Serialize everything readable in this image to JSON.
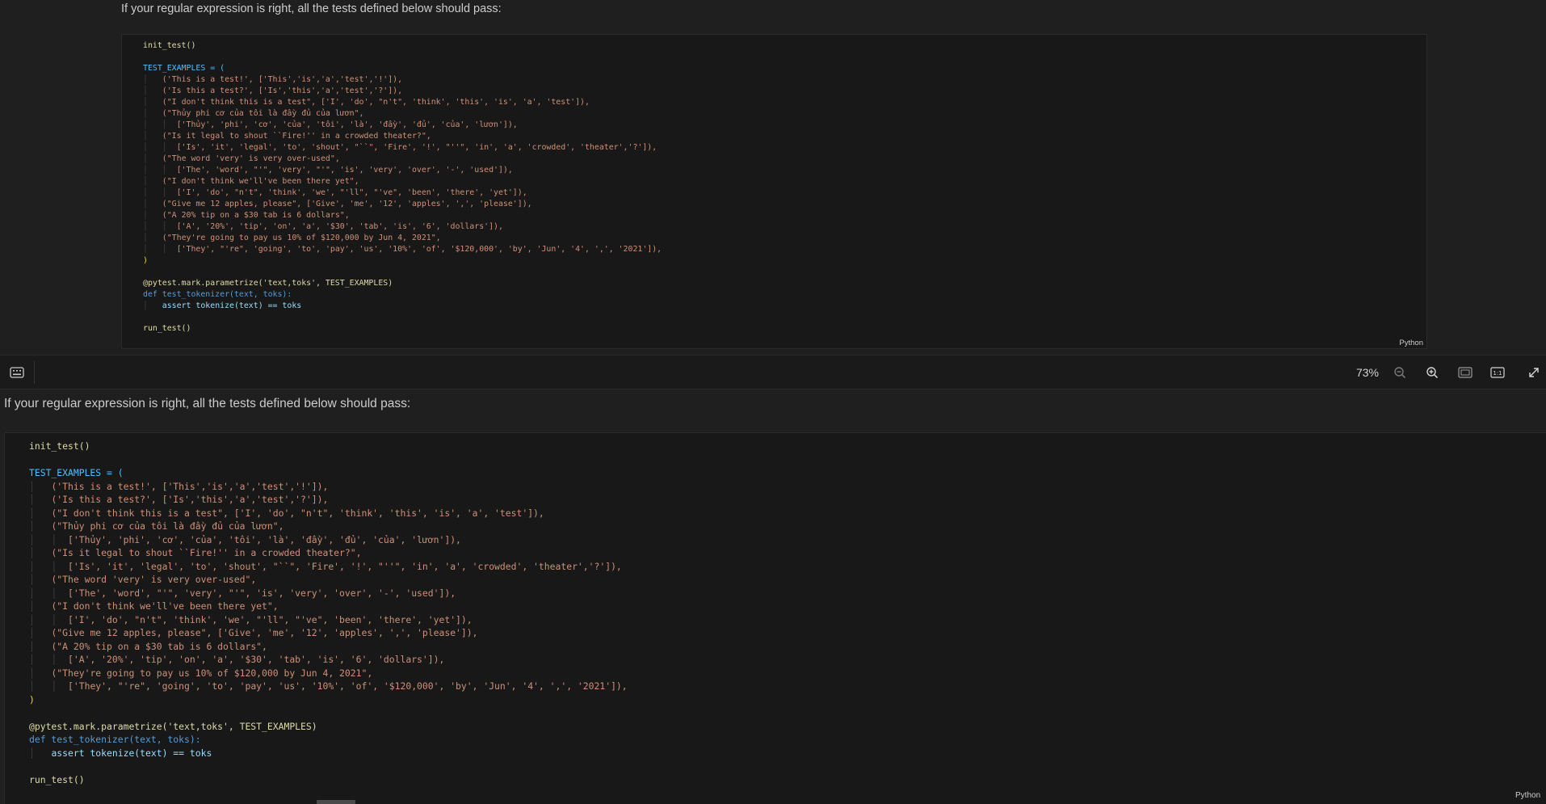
{
  "intro_text": "If your regular expression is right, all the tests defined below should pass:",
  "code_language": "Python",
  "code_lines": {
    "init": "init_test()",
    "assign": "TEST_EXAMPLES = (",
    "ex1": "('This is a test!', ['This','is','a','test','!']),",
    "ex2": "('Is this a test?', ['Is','this','a','test','?']),",
    "ex3": "(\"I don't think this is a test\", ['I', 'do', \"n't\", 'think', 'this', 'is', 'a', 'test']),",
    "ex4a": "(\"Thủy phi cơ của tôi là đầy đủ của lươn\",",
    "ex4b": "['Thủy', 'phi', 'cơ', 'của', 'tôi', 'là', 'đầy', 'đủ', 'của', 'lươn']),",
    "ex5a": "(\"Is it legal to shout ``Fire!'' in a crowded theater?\",",
    "ex5b": "['Is', 'it', 'legal', 'to', 'shout', \"``\", 'Fire', '!', \"''\", 'in', 'a', 'crowded', 'theater','?']),",
    "ex6a": "(\"The word 'very' is very over-used\",",
    "ex6b": "['The', 'word', \"'\", 'very', \"'\", 'is', 'very', 'over', '-', 'used']),",
    "ex7a": "(\"I don't think we'll've been there yet\",",
    "ex7b": "['I', 'do', \"n't\", 'think', 'we', \"'ll\", \"'ve\", 'been', 'there', 'yet']),",
    "ex8": "(\"Give me 12 apples, please\", ['Give', 'me', '12', 'apples', ',', 'please']),",
    "ex9a": "(\"A 20% tip on a $30 tab is 6 dollars\",",
    "ex9b": "['A', '20%', 'tip', 'on', 'a', '$30', 'tab', 'is', '6', 'dollars']),",
    "ex10a": "(\"They're going to pay us 10% of $120,000 by Jun 4, 2021\",",
    "ex10b": "['They', \"'re\", 'going', 'to', 'pay', 'us', '10%', 'of', '$120,000', 'by', 'Jun', '4', ',', '2021']),",
    "close": ")",
    "decorator": "@pytest.mark.parametrize('text,toks', TEST_EXAMPLES)",
    "def": "def test_tokenizer(text, toks):",
    "assert": "assert tokenize(text) == toks",
    "run": "run_test()"
  },
  "toolbar": {
    "zoom_level": "73%",
    "keyboard_icon": "keyboard-icon",
    "zoom_out_icon": "zoom-out-icon",
    "zoom_in_icon": "zoom-in-icon",
    "fit_icon": "fit-to-window-icon",
    "actual_size_icon": "actual-size-icon",
    "expand_icon": "expand-icon"
  }
}
